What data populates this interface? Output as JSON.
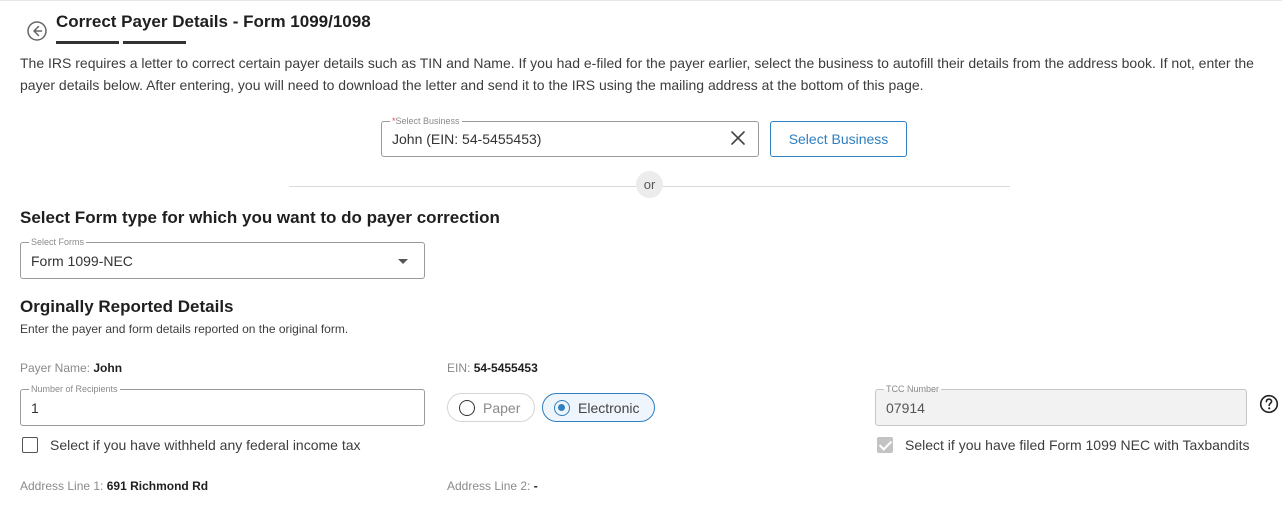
{
  "header": {
    "back_icon": "arrow-left-circle-icon",
    "title": "Correct Payer Details - Form 1099/1098"
  },
  "intro_text": "The IRS requires a letter to correct certain payer details such as TIN and Name. If you had e-filed for the payer earlier, select the business to autofill their details from the address book. If not, enter the payer details below. After entering, you will need to download the letter and send it to the IRS using the mailing address at the bottom of this page.",
  "business_select": {
    "required_mark": "*",
    "label": "Select Business",
    "value": "John (EIN: 54-5455453)",
    "clear_icon": "close-icon",
    "button_label": "Select Business"
  },
  "or_label": "or",
  "form_type": {
    "heading": "Select Form type for which you want to do payer correction",
    "label": "Select Forms",
    "value": "Form 1099-NEC",
    "dropdown_icon": "caret-down-icon"
  },
  "original_details": {
    "heading": "Orginally Reported Details",
    "subheading": "Enter the payer and form details reported on the original form.",
    "payer_name_label": "Payer Name:",
    "payer_name_value": "John",
    "ein_label": "EIN:",
    "ein_value": "54-5455453",
    "recipients_label": "Number of Recipients",
    "recipients_value": "1",
    "filing_method": {
      "options": [
        "Paper",
        "Electronic"
      ],
      "selected": "Electronic"
    },
    "tcc_label": "TCC Number",
    "tcc_value": "07914",
    "help_icon": "question-circle-icon",
    "withheld_checkbox_label": "Select if you have withheld any federal income tax",
    "withheld_checked": false,
    "taxbandits_checkbox_label": "Select if you have filed Form 1099 NEC with Taxbandits",
    "taxbandits_checked": true,
    "address_line1_label": "Address Line 1:",
    "address_line1_value": "691 Richmond Rd",
    "address_line2_label": "Address Line 2:",
    "address_line2_value": "-"
  },
  "colors": {
    "accent": "#2f7fc1",
    "required": "#e04a4a"
  }
}
